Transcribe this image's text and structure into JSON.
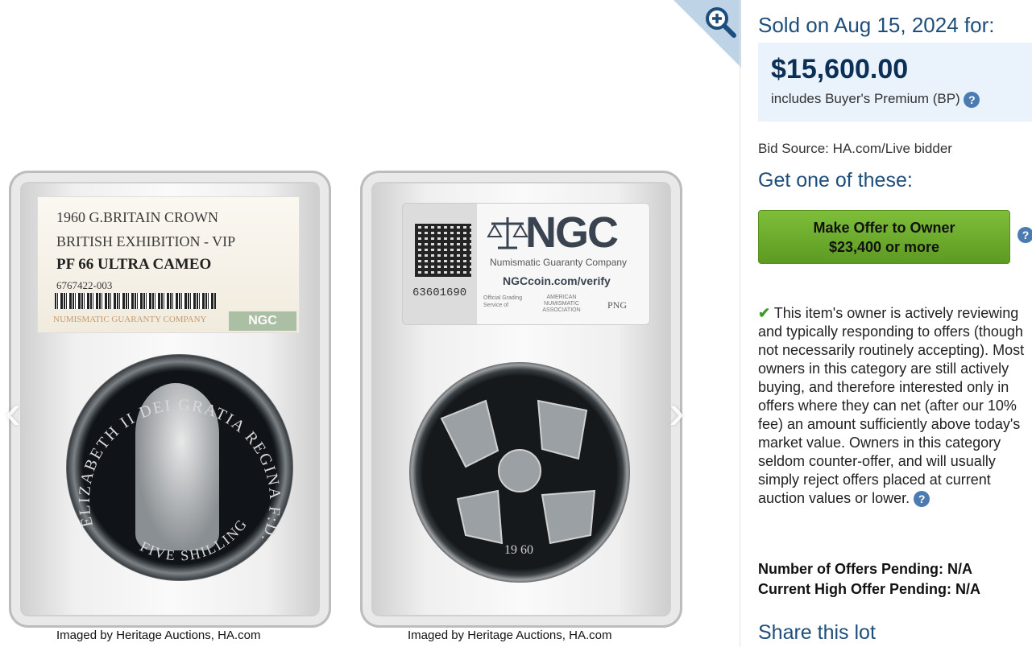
{
  "gallery": {
    "front_label": {
      "line1": "1960 G.BRITAIN CROWN",
      "line2": "BRITISH EXHIBITION - VIP",
      "grade": "PF 66 ULTRA CAMEO",
      "cert": "6767422-003",
      "company": "NUMISMATIC GUARANTY COMPANY",
      "badge": "NGC"
    },
    "front_coin": {
      "legend": "ELIZABETH II DEI GRATIA REGINA F:D:",
      "denomination": "FIVE SHILLINGS"
    },
    "back_label": {
      "serial": "63601690",
      "brand": "NGC",
      "company": "Numismatic Guaranty Company",
      "verify": "NGCcoin.com/verify",
      "official": "Official Grading Service of",
      "ana": "AMERICAN NUMISMATIC ASSOCIATION",
      "png": "PNG"
    },
    "back_coin": {
      "date": "19 60"
    },
    "caption_front": "Imaged by Heritage Auctions, HA.com",
    "caption_back": "Imaged by Heritage Auctions, HA.com",
    "prev_arrow": "‹",
    "next_arrow": "›"
  },
  "sale": {
    "sold_text": "Sold on Aug 15, 2024 for:",
    "price": "$15,600.00",
    "bp_text": "includes Buyer's Premium (BP)",
    "help_glyph": "?",
    "bid_source": "Bid Source: HA.com/Live bidder"
  },
  "offer": {
    "heading": "Get one of these:",
    "button_line1": "Make Offer to Owner",
    "button_line2": "$23,400 or more",
    "check_glyph": "✔",
    "owner_text": "This item's owner is actively reviewing and typically responding to offers (though not necessarily routinely accepting). Most owners in this category are still actively buying, and therefore interested only in offers where they can net (after our 10% fee) an amount sufficiently above today's market value. Owners in this category seldom counter-offer, and will usually simply reject offers placed at current auction values or lower.",
    "offers_pending": "Number of Offers Pending: N/A",
    "high_offer": "Current High Offer Pending: N/A"
  },
  "share": {
    "heading": "Share this lot"
  },
  "colors": {
    "heading_blue": "#1d4e7c",
    "button_green": "#6aa82c",
    "price_box": "#eaf2fb"
  },
  "icons": {
    "zoom": "zoom-in-icon",
    "help": "help-icon",
    "check": "check-icon"
  }
}
